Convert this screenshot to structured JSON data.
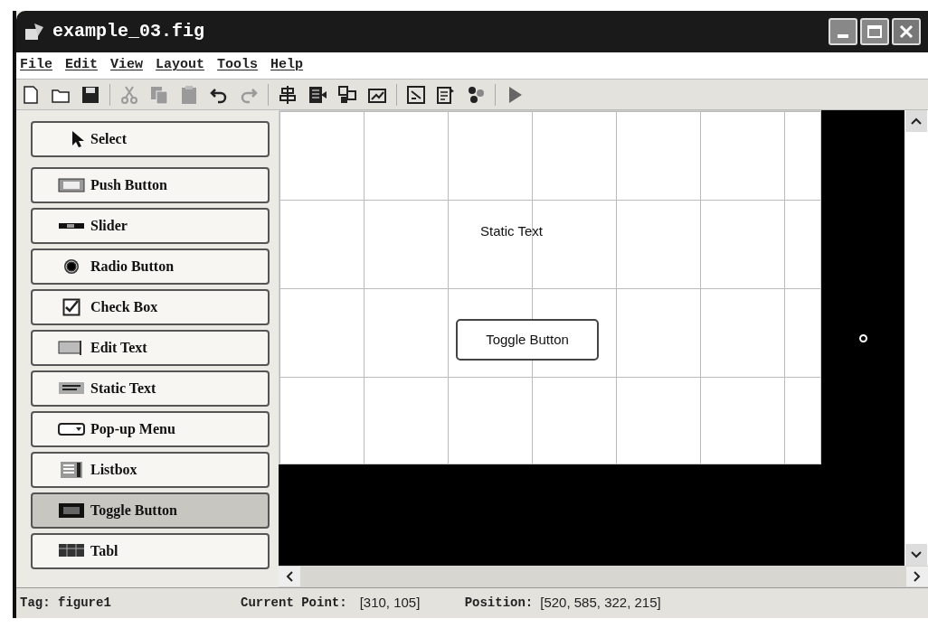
{
  "window": {
    "title": "example_03.fig"
  },
  "menu": [
    "File",
    "Edit",
    "View",
    "Layout",
    "Tools",
    "Help"
  ],
  "toolbar": [
    {
      "kind": "new",
      "disabled": false
    },
    {
      "kind": "open",
      "disabled": false
    },
    {
      "kind": "save",
      "disabled": false
    },
    {
      "kind": "sep"
    },
    {
      "kind": "cut",
      "disabled": true
    },
    {
      "kind": "copy",
      "disabled": true
    },
    {
      "kind": "paste",
      "disabled": true
    },
    {
      "kind": "undo",
      "disabled": false
    },
    {
      "kind": "redo",
      "disabled": true
    },
    {
      "kind": "sep"
    },
    {
      "kind": "align",
      "disabled": false
    },
    {
      "kind": "menu-editor",
      "disabled": false
    },
    {
      "kind": "tab-order",
      "disabled": false
    },
    {
      "kind": "toolbar-editor",
      "disabled": false
    },
    {
      "kind": "sep"
    },
    {
      "kind": "editor",
      "disabled": false
    },
    {
      "kind": "inspector",
      "disabled": false
    },
    {
      "kind": "browser",
      "disabled": false
    },
    {
      "kind": "sep"
    },
    {
      "kind": "run",
      "disabled": false
    }
  ],
  "palette": [
    {
      "kind": "select",
      "label": "Select",
      "selected": false
    },
    {
      "kind": "push",
      "label": "Push Button",
      "selected": false
    },
    {
      "kind": "slider",
      "label": "Slider",
      "selected": false
    },
    {
      "kind": "radio",
      "label": "Radio Button",
      "selected": false
    },
    {
      "kind": "check",
      "label": "Check Box",
      "selected": false
    },
    {
      "kind": "edit",
      "label": "Edit Text",
      "selected": false
    },
    {
      "kind": "static",
      "label": "Static Text",
      "selected": false
    },
    {
      "kind": "popup",
      "label": "Pop-up Menu",
      "selected": false
    },
    {
      "kind": "listbox",
      "label": "Listbox",
      "selected": false
    },
    {
      "kind": "toggle",
      "label": "Toggle Button",
      "selected": true
    },
    {
      "kind": "table",
      "label": "Tabl",
      "selected": false
    }
  ],
  "canvas": {
    "static_text": "Static Text",
    "toggle_button": "Toggle Button"
  },
  "status_bar": {
    "tag": "Tag: figure1",
    "current_point_label": "Current Point:",
    "current_point": "[310, 105]",
    "position_label": "Position:",
    "position": "[520, 585, 322, 215]"
  }
}
